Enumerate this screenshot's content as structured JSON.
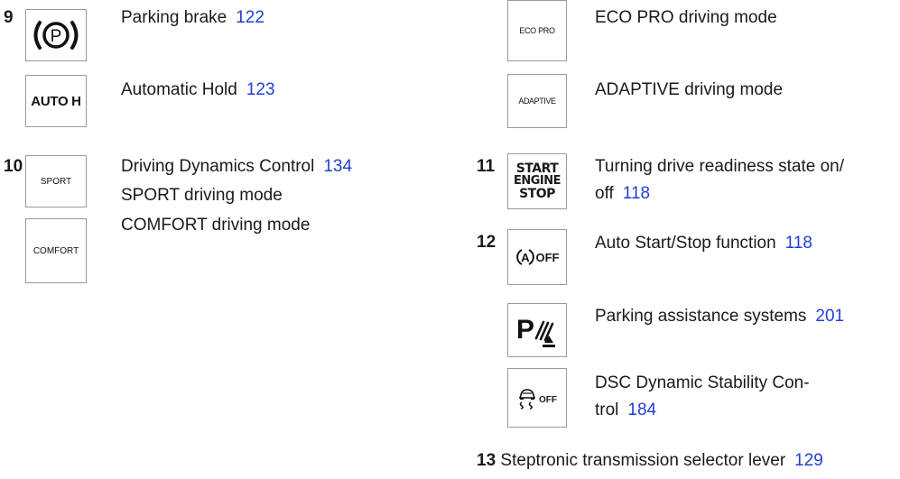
{
  "left": {
    "items": [
      {
        "number": "9",
        "label": "Parking brake",
        "page": "122"
      },
      {
        "number": "",
        "label": "Automatic Hold",
        "page": "123",
        "icon_text": "AUTO H"
      },
      {
        "number": "10",
        "label": "Driving Dynamics Control",
        "page": "134",
        "line2": "SPORT driving mode",
        "icon_text": "SPORT"
      },
      {
        "number": "",
        "label": "COMFORT driving mode",
        "icon_text": "COMFORT"
      }
    ]
  },
  "right": {
    "items": [
      {
        "label": "ECO PRO driving mode",
        "icon_text": "ECO PRO"
      },
      {
        "label": "ADAPTIVE driving mode",
        "icon_text": "ADAPTIVE"
      },
      {
        "number": "11",
        "label_line1": "Turning drive readiness state on/",
        "label_line2": "off",
        "page": "118",
        "icon_line1": "START",
        "icon_line2": "ENGINE",
        "icon_line3": "STOP"
      },
      {
        "number": "12",
        "label": "Auto Start/Stop function",
        "page": "118",
        "icon_text": "OFF"
      },
      {
        "label": "Parking assistance systems",
        "page": "201"
      },
      {
        "label_line1": "DSC Dynamic Stability Con-",
        "label_line2": "trol",
        "page": "184",
        "icon_text": "OFF"
      },
      {
        "number": "13",
        "label": "Steptronic transmission selector lever",
        "page": "129"
      }
    ]
  },
  "colors": {
    "link": "#1f3fd8",
    "text": "#1a1a1a",
    "border": "#9a9a9a"
  }
}
